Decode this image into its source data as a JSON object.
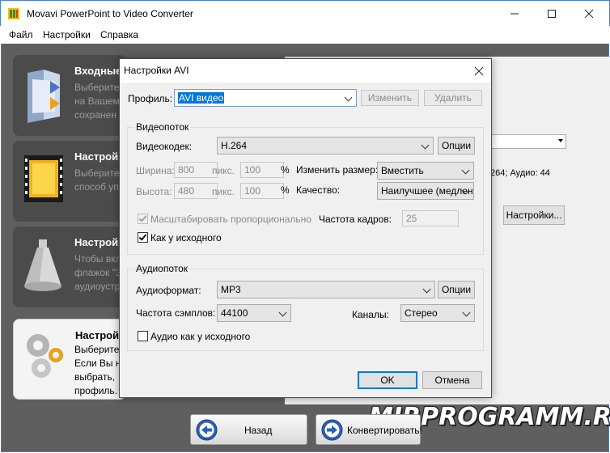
{
  "app": {
    "title": "Movavi PowerPoint to Video Converter"
  },
  "menu": {
    "file": "Файл",
    "settings": "Настройки",
    "help": "Справка"
  },
  "steps": [
    {
      "title": "Входные",
      "desc": "Выберите\nна Вашем\nсохранен"
    },
    {
      "title": "Настрой",
      "desc": "Выберите\nспособ уп"
    },
    {
      "title": "Настрой",
      "desc": "Чтобы вкл\nфлажок \"З\nаудиоустр"
    },
    {
      "title": "Настрой",
      "desc": "Выберите\nЕсли Вы н\nвыбрать,\nпрофиль."
    }
  ],
  "right_panel": {
    "info_text": "264; Аудио: 44",
    "settings_button": "Настройки..."
  },
  "bottom": {
    "back_button": "Назад",
    "convert_button": "Конвертировать!"
  },
  "watermark": "MIRPROGRAMM.RU",
  "dialog": {
    "title": "Настройки AVI",
    "profile_label": "Профиль:",
    "profile_value": "AVI видео",
    "edit_button": "Изменить",
    "delete_button": "Удалить",
    "video_group": "Видеопоток",
    "video_codec_label": "Видеокодек:",
    "video_codec_value": "H.264",
    "options_button": "Опции",
    "width_label": "Ширина:",
    "width_value": "800",
    "px_label": "пикс.",
    "width_pct": "100",
    "pct_sign": "%",
    "resize_label": "Изменить размер:",
    "resize_value": "Вместить",
    "height_label": "Высота:",
    "height_value": "480",
    "height_pct": "100",
    "quality_label": "Качество:",
    "quality_value": "Наилучшее (медлен",
    "scale_label": "Масштабировать пропорционально",
    "framerate_label": "Частота кадров:",
    "framerate_value": "25",
    "as_source_label": "Как у исходного",
    "audio_group": "Аудиопоток",
    "audio_format_label": "Аудиоформат:",
    "audio_format_value": "MP3",
    "sample_rate_label": "Частота сэмплов:",
    "sample_rate_value": "44100",
    "channels_label": "Каналы:",
    "channels_value": "Стерео",
    "audio_as_source_label": "Аудио как у исходного",
    "ok_button": "OK",
    "cancel_button": "Отмена"
  }
}
